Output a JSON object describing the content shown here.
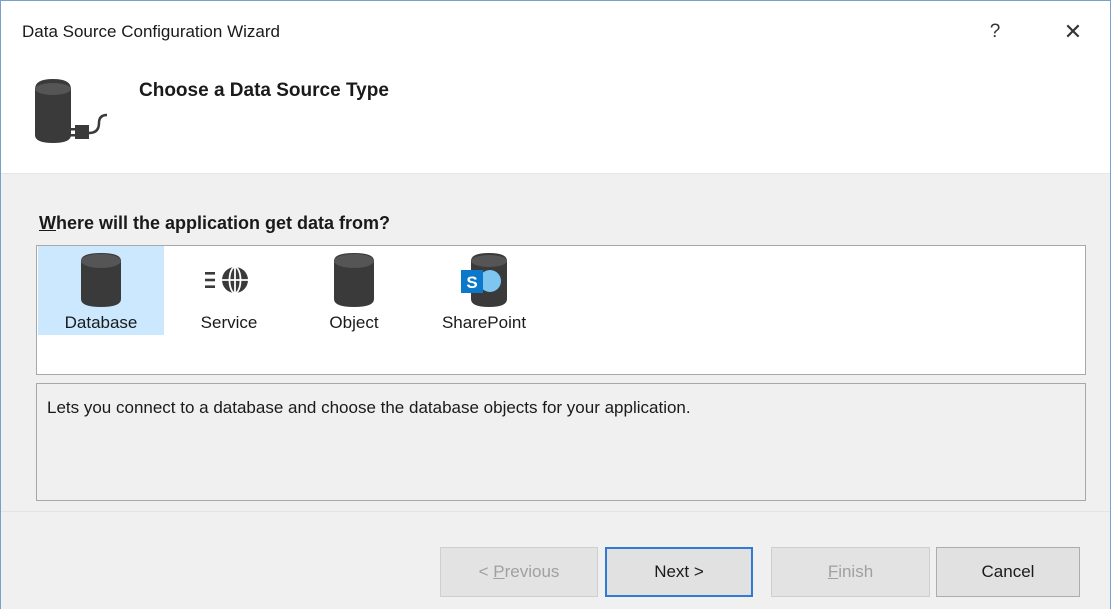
{
  "window": {
    "title": "Data Source Configuration Wizard",
    "help_glyph": "?",
    "close_glyph": "✕"
  },
  "header": {
    "title": "Choose a Data Source Type"
  },
  "question": {
    "underlined": "W",
    "rest": "here will the application get data from?"
  },
  "sources": [
    {
      "label": "Database",
      "icon": "database-icon",
      "selected": true
    },
    {
      "label": "Service",
      "icon": "service-globe-icon",
      "selected": false
    },
    {
      "label": "Object",
      "icon": "object-icon",
      "selected": false
    },
    {
      "label": "SharePoint",
      "icon": "sharepoint-icon",
      "selected": false
    }
  ],
  "description": "Lets you connect to a database and choose the database objects for your application.",
  "buttons": {
    "previous_prefix": "< ",
    "previous_mnemonic": "P",
    "previous_rest": "revious",
    "next": "Next >",
    "finish_mnemonic": "F",
    "finish_rest": "inish",
    "cancel": "Cancel"
  },
  "colors": {
    "selection": "#cce8ff",
    "default_button_border": "#2f7ad3",
    "sharepoint_blue": "#0b78c9"
  }
}
